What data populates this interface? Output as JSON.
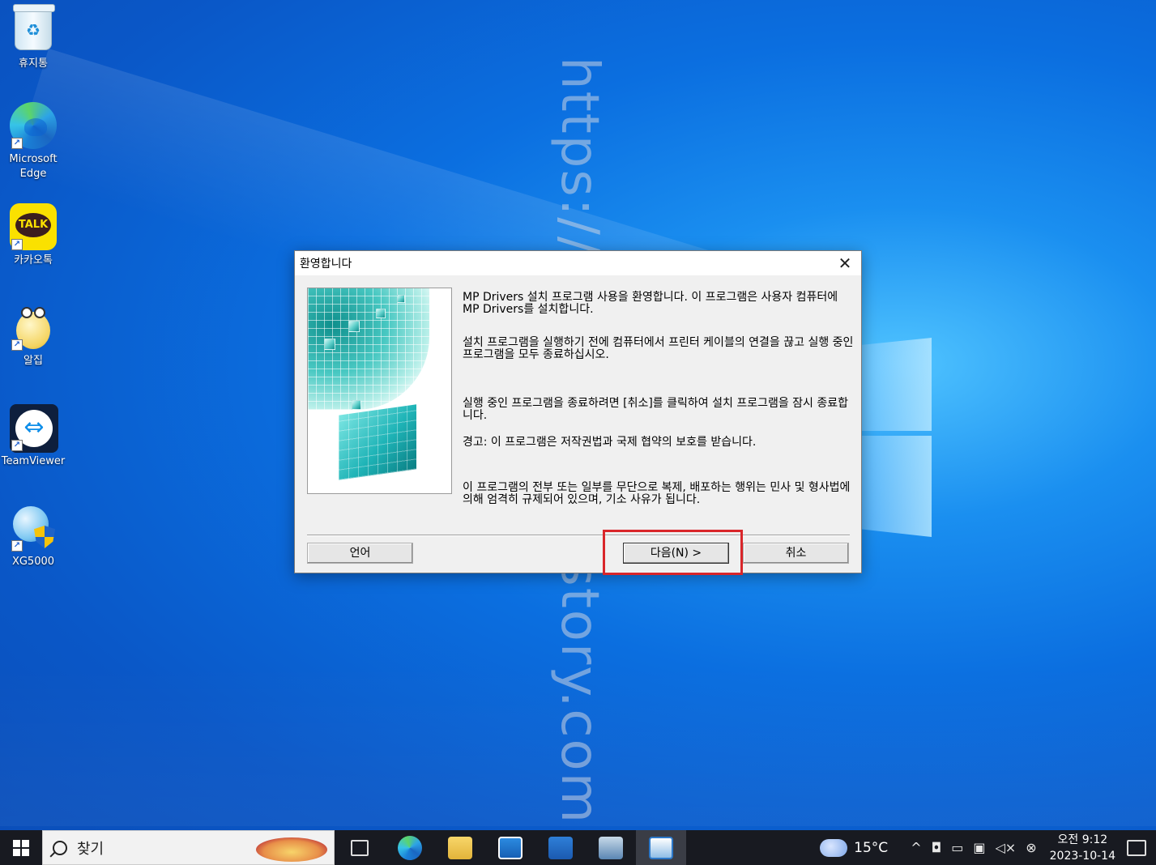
{
  "desktop": {
    "watermark": "https://kshnblog.tistory.com",
    "icons": [
      {
        "label": "휴지통"
      },
      {
        "label": "Microsoft Edge"
      },
      {
        "label": "카카오톡",
        "badge": "TALK"
      },
      {
        "label": "알집"
      },
      {
        "label": "TeamViewer"
      },
      {
        "label": "XG5000"
      }
    ]
  },
  "dialog": {
    "title": "환영합니다",
    "messages": [
      "MP Drivers 설치 프로그램 사용을 환영합니다. 이 프로그램은 사용자 컴퓨터에 MP Drivers를 설치합니다.",
      "설치 프로그램을 실행하기 전에 컴퓨터에서 프린터 케이블의 연결을 끊고 실행 중인 프로그램을 모두 종료하십시오.",
      "실행 중인 프로그램을 종료하려면 [취소]를 클릭하여 설치 프로그램을 잠시 종료합니다.",
      "경고: 이 프로그램은 저작권법과 국제 협약의 보호를 받습니다.",
      "이 프로그램의 전부 또는 일부를 무단으로 복제, 배포하는 행위는 민사 및 형사법에 의해 엄격히 규제되어 있으며, 기소 사유가 됩니다."
    ],
    "buttons": {
      "language": "언어",
      "next": "다음(N) >",
      "cancel": "취소"
    },
    "highlight_color": "#d9262a"
  },
  "taskbar": {
    "search_placeholder": "찾기",
    "weather": "15°C",
    "time": "오전 9:12",
    "date": "2023-10-14",
    "pinned": [
      "task-view-icon",
      "edge-icon",
      "file-explorer-icon",
      "store-icon",
      "mail-icon",
      "setup-icon",
      "active-app-icon"
    ]
  }
}
